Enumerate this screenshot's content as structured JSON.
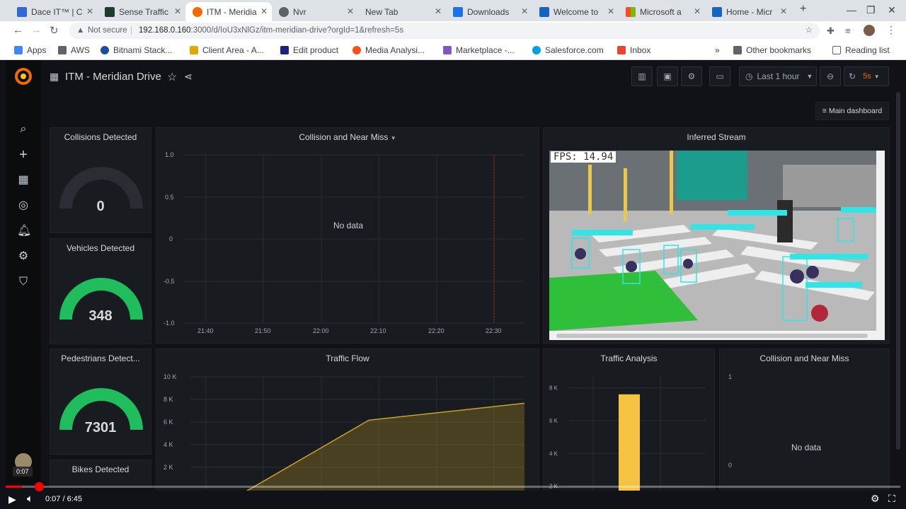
{
  "tabs": [
    {
      "title": "Dace IT™ | C",
      "color": "#3367d6"
    },
    {
      "title": "Sense Traffic",
      "color": "#1e3b2d"
    },
    {
      "title": "ITM - Meridia",
      "color": "#f46800"
    },
    {
      "title": "Nvr",
      "color": "#5f6368"
    },
    {
      "title": "New Tab",
      "color": ""
    },
    {
      "title": "Downloads",
      "color": "#1a73e8"
    },
    {
      "title": "Welcome to",
      "color": "#1565c0"
    },
    {
      "title": "Microsoft a",
      "color": "#f25022"
    },
    {
      "title": "Home - Micr",
      "color": "#1565c0"
    }
  ],
  "address": {
    "security": "Not secure",
    "url_host": "192.168.0.160",
    "url_rest": ":3000/d/IoU3xNlGz/itm-meridian-drive?orgId=1&refresh=5s"
  },
  "bookmarks": [
    {
      "label": "Apps",
      "color": "#4285f4"
    },
    {
      "label": "AWS",
      "color": "#5f6368"
    },
    {
      "label": "Bitnami Stack...",
      "color": "#1b4f9b"
    },
    {
      "label": "Client Area - A...",
      "color": "#e0a800"
    },
    {
      "label": "Edit product",
      "color": "#1a237e"
    },
    {
      "label": "Media Analysi...",
      "color": "#f4511e"
    },
    {
      "label": "Marketplace -...",
      "color": "#7e57c2"
    },
    {
      "label": "Salesforce.com",
      "color": "#00a1e0"
    },
    {
      "label": "Inbox",
      "color": "#ea4335"
    }
  ],
  "bookmarks_right": {
    "other": "Other bookmarks",
    "reading": "Reading list",
    "more": "»"
  },
  "dashboard": {
    "title": "ITM - Meridian Drive",
    "time_range": "Last 1 hour",
    "refresh": "5s",
    "main_dashboard_link": "Main dashboard"
  },
  "panels": {
    "collisions": {
      "title": "Collisions Detected",
      "value": "0",
      "fraction": 0
    },
    "vehicles": {
      "title": "Vehicles Detected",
      "value": "348",
      "fraction": 1
    },
    "pedestrians": {
      "title": "Pedestrians Detect...",
      "value": "7301",
      "fraction": 1
    },
    "bikes": {
      "title": "Bikes Detected"
    },
    "collision_chart": {
      "title": "Collision and Near Miss",
      "no_data": "No data",
      "y_ticks": [
        "1.0",
        "0.5",
        "0",
        "-0.5",
        "-1.0"
      ],
      "x_ticks": [
        "21:40",
        "21:50",
        "22:00",
        "22:10",
        "22:20",
        "22:30"
      ]
    },
    "stream": {
      "title": "Inferred Stream",
      "fps": "FPS: 14.94"
    },
    "traffic_flow": {
      "title": "Traffic Flow"
    },
    "traffic_analysis": {
      "title": "Traffic Analysis"
    },
    "collision_small": {
      "title": "Collision and Near Miss",
      "no_data": "No data",
      "y_ticks": [
        "1",
        "0"
      ]
    }
  },
  "chart_data": [
    {
      "type": "area",
      "title": "Traffic Flow",
      "y_ticks": [
        "10 K",
        "8 K",
        "6 K",
        "4 K",
        "2 K"
      ],
      "ylim": [
        0,
        10000
      ],
      "series": [
        {
          "values": [
            {
              "x": 0,
              "y": 0
            },
            {
              "x": 0.5,
              "y": 6100
            },
            {
              "x": 1,
              "y": 7600
            }
          ]
        }
      ],
      "color": "#c9a227"
    },
    {
      "type": "bar",
      "title": "Traffic Analysis",
      "y_ticks": [
        "8 K",
        "6 K",
        "4 K",
        "2 K"
      ],
      "ylim": [
        0,
        8800
      ],
      "values": [
        7600
      ],
      "color": "#f5c242"
    }
  ],
  "video": {
    "time": "0:07 / 6:45",
    "tooltip": "0:07",
    "progress": 0.018
  }
}
